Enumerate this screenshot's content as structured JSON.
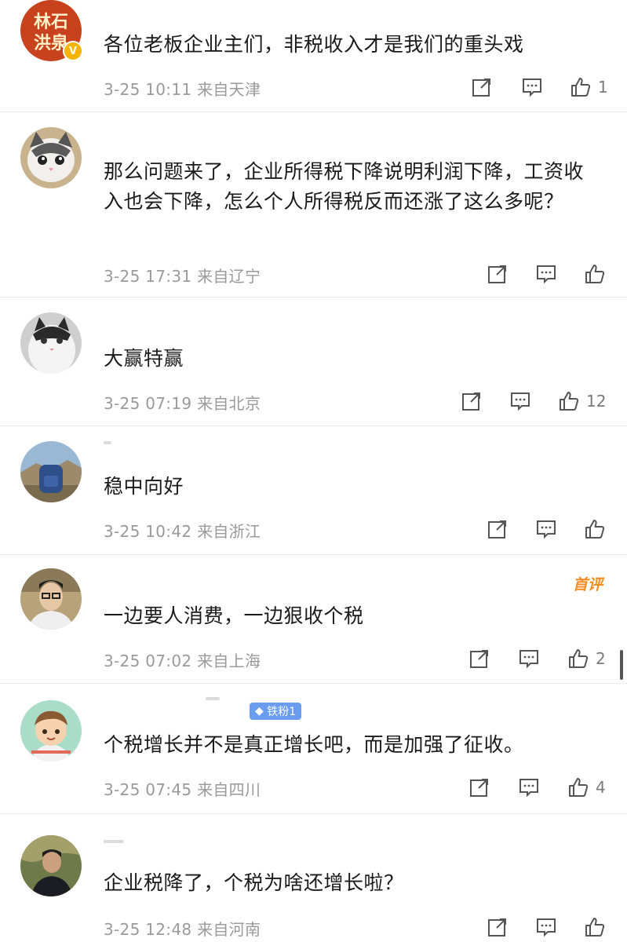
{
  "comments": [
    {
      "text": "各位老板企业主们，非税收入才是我们的重头戏",
      "date": "3-25 10:11",
      "location": "来自天津",
      "likes": "1",
      "avatar_text": "林石\n洪泉",
      "verified_badge": "V"
    },
    {
      "text": "那么问题来了，企业所得税下降说明利润下降，工资收入也会下降，怎么个人所得税反而还涨了这么多呢？",
      "date": "3-25 17:31",
      "location": "来自辽宁",
      "likes": ""
    },
    {
      "text": "大赢特赢",
      "date": "3-25 07:19",
      "location": "来自北京",
      "likes": "12"
    },
    {
      "text": "稳中向好",
      "date": "3-25 10:42",
      "location": "来自浙江",
      "likes": ""
    },
    {
      "text": "一边要人消费，一边狠收个税",
      "date": "3-25 07:02",
      "location": "来自上海",
      "likes": "2",
      "tag": "首评"
    },
    {
      "text": "个税增长并不是真正增长吧，而是加强了征收。",
      "date": "3-25 07:45",
      "location": "来自四川",
      "likes": "4",
      "badge": "铁粉1"
    },
    {
      "text": "企业税降了，个税为啥还增长啦？",
      "date": "3-25 12:48",
      "location": "来自河南",
      "likes": ""
    }
  ],
  "icons": {
    "share": "share-icon",
    "comment": "comment-icon",
    "like": "like-icon"
  },
  "colors": {
    "tag": "#f28b22",
    "fan_badge": "#6a9cf0",
    "verified": "#f5b400"
  }
}
